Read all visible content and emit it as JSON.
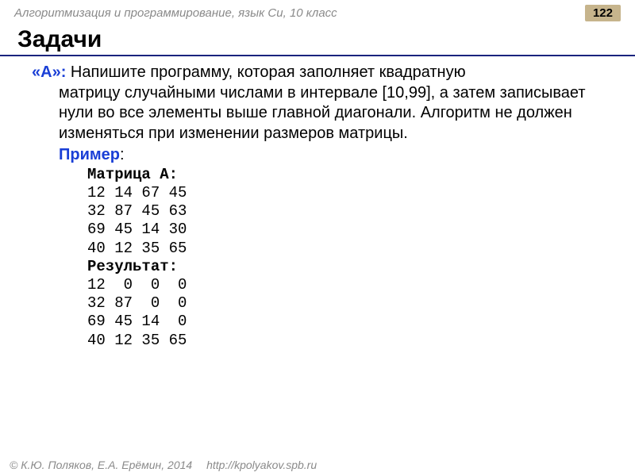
{
  "header": {
    "breadcrumb": "Алгоритмизация и программирование, язык Си, 10 класс",
    "page_number": "122"
  },
  "title": "Задачи",
  "task": {
    "label": "«A»:",
    "text_first": " Напишите программу, которая заполняет квадратную",
    "text_rest": "матрицу случайными числами в интервале [10,99], а затем записывает нули во все элементы выше главной диагонали. Алгоритм не должен изменяться при изменении размеров матрицы."
  },
  "example": {
    "label": "Пример",
    "colon": ":",
    "matrix_label": "Матрица А:",
    "matrix_rows": [
      "12 14 67 45",
      "32 87 45 63",
      "69 45 14 30",
      "40 12 35 65"
    ],
    "result_label": "Результат:",
    "result_rows": [
      "12  0  0  0",
      "32 87  0  0",
      "69 45 14  0",
      "40 12 35 65"
    ]
  },
  "footer": {
    "copyright": "© К.Ю. Поляков, Е.А. Ерёмин, 2014",
    "url": "http://kpolyakov.spb.ru"
  }
}
